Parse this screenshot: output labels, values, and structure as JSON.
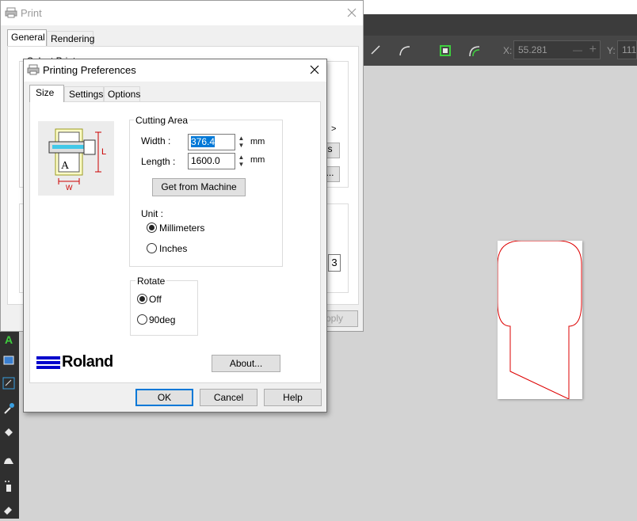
{
  "app": {
    "props": {
      "x_label": "X:",
      "x_value": "55.281",
      "y_label": "Y:",
      "y_value": "111"
    }
  },
  "print_dialog": {
    "title": "Print",
    "tabs": [
      {
        "label": "General"
      },
      {
        "label": "Rendering"
      }
    ],
    "group_label": "Select Printer",
    "page_count_glyph": "3",
    "partial_button": "s",
    "ellipsis_button": "...",
    "apply_label": "Apply"
  },
  "pref_dialog": {
    "title": "Printing Preferences",
    "tabs": [
      {
        "label": "Size"
      },
      {
        "label": "Settings"
      },
      {
        "label": "Options"
      }
    ],
    "diagram": {
      "letter_a": "A",
      "label_l": "L",
      "label_w": "W"
    },
    "cutting_area": {
      "legend": "Cutting Area",
      "width_label": "Width :",
      "width_value": "376.4",
      "length_label": "Length :",
      "length_value": "1600.0",
      "unit_mm": "mm",
      "get_from_machine": "Get from Machine",
      "unit_label": "Unit :",
      "unit_options": [
        {
          "label": "Millimeters",
          "checked": true
        },
        {
          "label": "Inches",
          "checked": false
        }
      ]
    },
    "rotate": {
      "legend": "Rotate",
      "options": [
        {
          "label": "Off",
          "checked": true
        },
        {
          "label": "90deg",
          "checked": false
        }
      ]
    },
    "logo_text": "Roland",
    "about_button": "About...",
    "ok_button": "OK",
    "cancel_button": "Cancel",
    "help_button": "Help"
  },
  "colors": {
    "accent": "#0078d7",
    "roland_blue": "#0000cc",
    "shape_outline": "#dd0000"
  }
}
